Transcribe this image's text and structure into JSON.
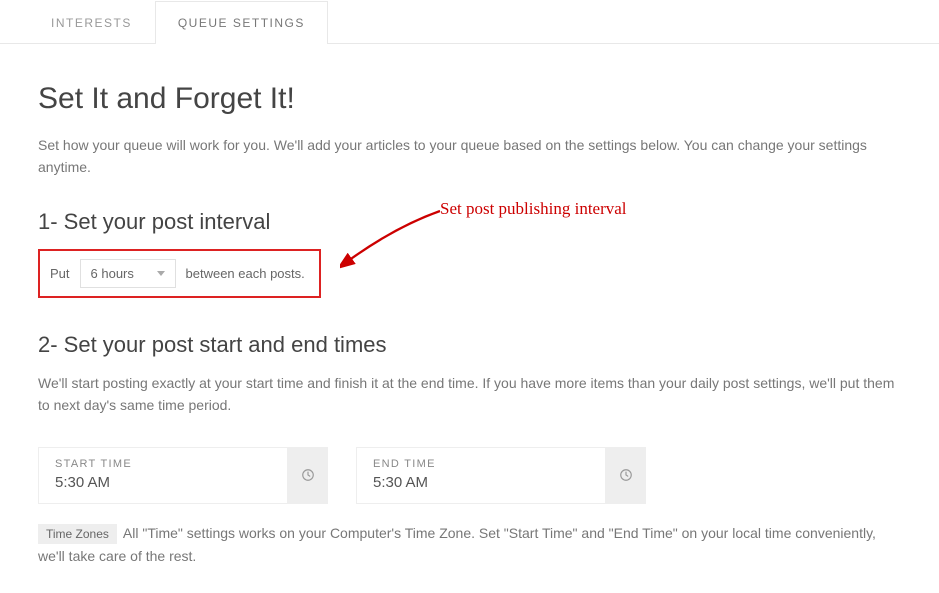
{
  "tabs": {
    "interests": "INTERESTS",
    "queue": "QUEUE SETTINGS"
  },
  "page": {
    "title": "Set It and Forget It!",
    "intro": "Set how your queue will work for you. We'll add your articles to your queue based on the settings below. You can change your settings anytime."
  },
  "section1": {
    "heading": "1- Set your post interval",
    "put": "Put",
    "interval": "6 hours",
    "between": "between each posts.",
    "annotation": "Set post publishing interval"
  },
  "section2": {
    "heading": "2- Set your post start and end times",
    "desc": "We'll start posting exactly at your start time and finish it at the end time. If you have more items than your daily post settings, we'll put them to next day's same time period.",
    "start_label": "START TIME",
    "start_value": "5:30 AM",
    "end_label": "END TIME",
    "end_value": "5:30 AM",
    "tz_badge": "Time Zones",
    "tz_text": "All \"Time\" settings works on your Computer's Time Zone. Set \"Start Time\" and \"End Time\" on your local time conveniently, we'll take care of the rest."
  }
}
